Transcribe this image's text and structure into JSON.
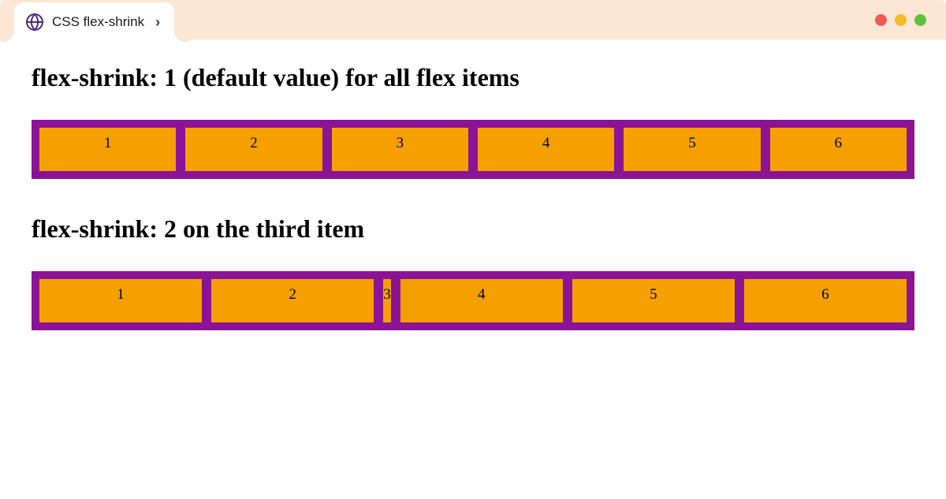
{
  "tab": {
    "title": "CSS flex-shrink"
  },
  "colors": {
    "container_bg": "#8a1396",
    "item_bg": "#f5a000",
    "chrome_bg": "#fce7d4"
  },
  "examples": [
    {
      "heading": "flex-shrink: 1 (default value) for all flex items",
      "items": [
        "1",
        "2",
        "3",
        "4",
        "5",
        "6"
      ],
      "shrink_index": null
    },
    {
      "heading": "flex-shrink: 2 on the third item",
      "items": [
        "1",
        "2",
        "3",
        "4",
        "5",
        "6"
      ],
      "shrink_index": 2
    }
  ]
}
